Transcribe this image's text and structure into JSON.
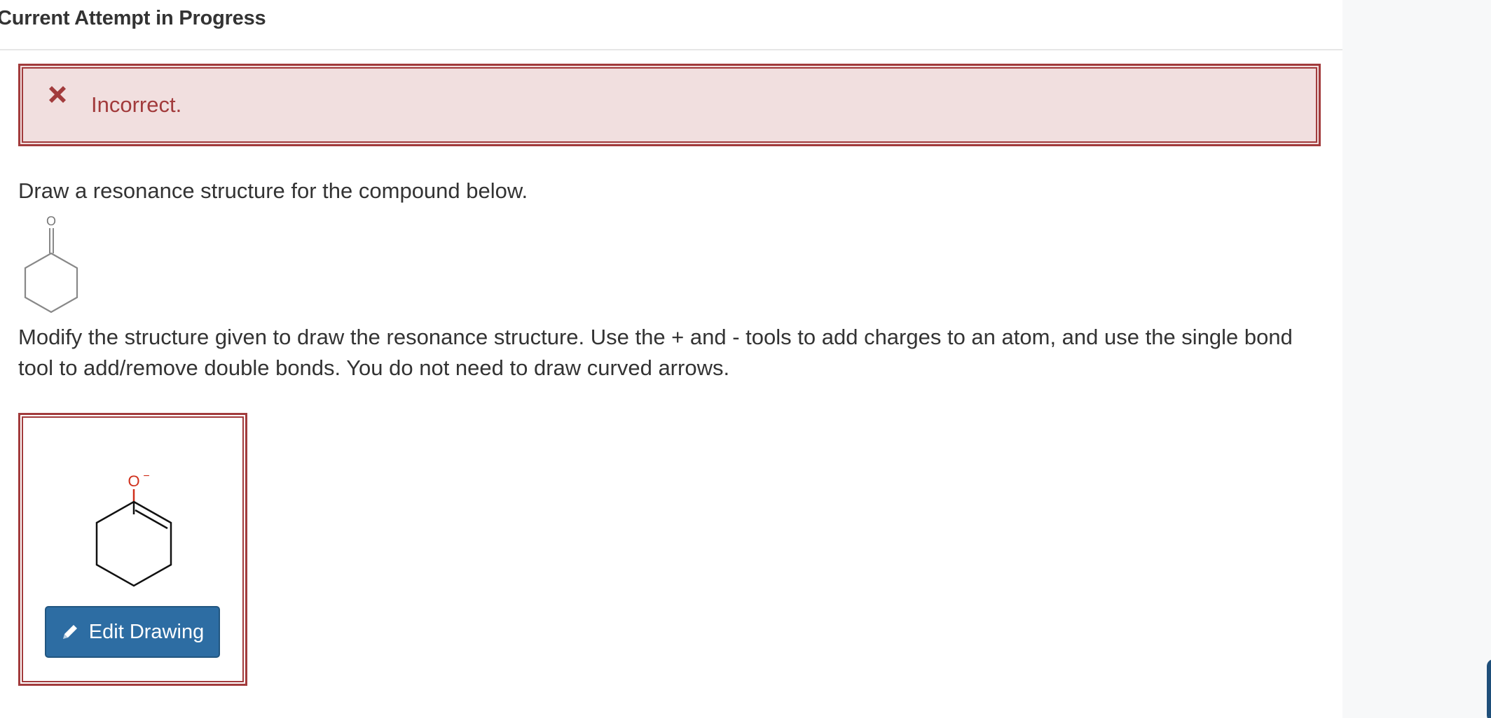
{
  "header": {
    "title": "Current Attempt in Progress"
  },
  "feedback": {
    "status": "Incorrect.",
    "icon": "x-mark-icon",
    "color": "#a23b3c",
    "background": "#f1dfdf"
  },
  "question": {
    "prompt": "Draw a resonance structure for the compound below.",
    "given_structure": {
      "icon": "cyclohexanone-structure",
      "atom_label": "O"
    },
    "instructions": "Modify the structure given to draw the resonance structure. Use the + and - tools to add charges to an atom, and use the single bond tool to add/remove double bonds. You do not need to draw curved arrows."
  },
  "answer": {
    "structure": {
      "icon": "enolate-structure",
      "atom_label": "O",
      "charge": "−",
      "atom_color": "#d0301c"
    },
    "edit_button": {
      "label": "Edit Drawing",
      "icon": "pencil-icon",
      "color": "#2d6da3"
    }
  }
}
